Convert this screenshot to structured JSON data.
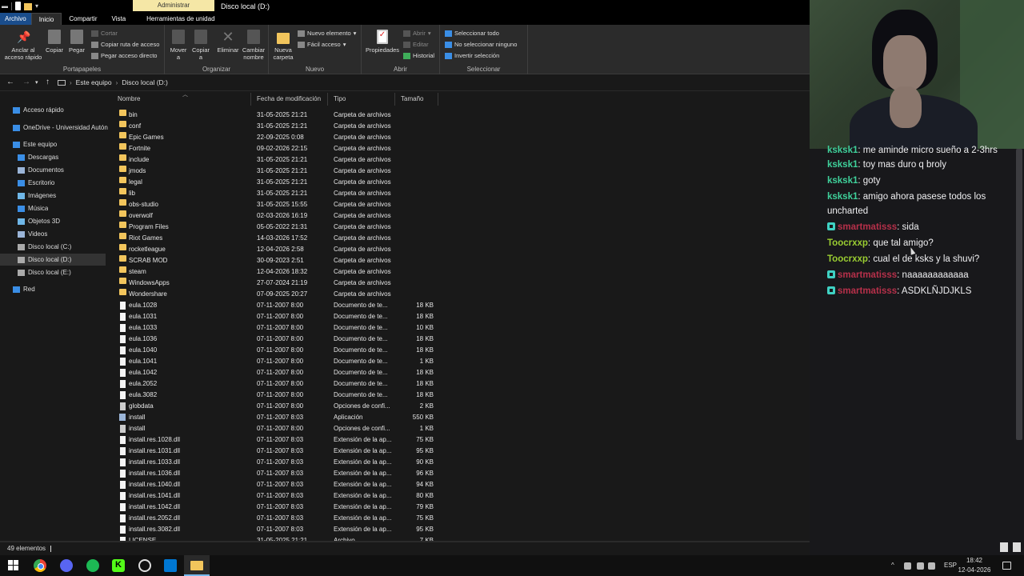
{
  "window": {
    "contextual_tab_title": "Administrar",
    "title": "Disco local (D:)"
  },
  "ribbon_tabs": [
    "Archivo",
    "Inicio",
    "Compartir",
    "Vista",
    "Herramientas de unidad"
  ],
  "ribbon": {
    "clipboard": {
      "pin_label": "Anclar al acceso rápido",
      "copy_label": "Copiar",
      "paste_label": "Pegar",
      "cut_label": "Cortar",
      "copy_path_label": "Copiar ruta de acceso",
      "paste_shortcut_label": "Pegar acceso directo",
      "group_label": "Portapapeles"
    },
    "organize": {
      "move_label": "Mover a",
      "copy_to_label": "Copiar a",
      "delete_label": "Eliminar",
      "rename_label": "Cambiar nombre",
      "group_label": "Organizar"
    },
    "new": {
      "new_folder_label": "Nueva carpeta",
      "new_item_label": "Nuevo elemento",
      "easy_access_label": "Fácil acceso",
      "group_label": "Nuevo"
    },
    "open": {
      "properties_label": "Propiedades",
      "open_label": "Abrir",
      "edit_label": "Editar",
      "history_label": "Historial",
      "group_label": "Abrir"
    },
    "select": {
      "select_all_label": "Seleccionar todo",
      "select_none_label": "No seleccionar ninguno",
      "invert_label": "Invertir selección",
      "group_label": "Seleccionar"
    }
  },
  "address": {
    "crumbs": [
      "Este equipo",
      "Disco local (D:)"
    ]
  },
  "nav_pane": [
    {
      "label": "Acceso rápido",
      "icon": "star-icon",
      "color": "#3a8ee6"
    },
    {
      "label": "OneDrive - Universidad Autón",
      "icon": "cloud-icon",
      "color": "#3a8ee6"
    },
    {
      "label": "Este equipo",
      "icon": "pc-icon",
      "color": "#3a8ee6"
    },
    {
      "label": "Descargas",
      "icon": "download-icon",
      "color": "#3a8ee6"
    },
    {
      "label": "Documentos",
      "icon": "document-icon",
      "color": "#9bb5d8"
    },
    {
      "label": "Escritorio",
      "icon": "desktop-icon",
      "color": "#3a8ee6"
    },
    {
      "label": "Imágenes",
      "icon": "image-icon",
      "color": "#6fb7e8"
    },
    {
      "label": "Música",
      "icon": "music-icon",
      "color": "#3a8ee6"
    },
    {
      "label": "Objetos 3D",
      "icon": "cube-icon",
      "color": "#6fb7e8"
    },
    {
      "label": "Videos",
      "icon": "video-icon",
      "color": "#9bb5d8"
    },
    {
      "label": "Disco local (C:)",
      "icon": "drive-icon",
      "color": "#aaa"
    },
    {
      "label": "Disco local (D:)",
      "icon": "drive-icon",
      "color": "#aaa",
      "selected": true
    },
    {
      "label": "Disco local (E:)",
      "icon": "drive-icon",
      "color": "#aaa"
    },
    {
      "label": "Red",
      "icon": "network-icon",
      "color": "#3a8ee6"
    }
  ],
  "columns": {
    "name": "Nombre",
    "modified": "Fecha de modificación",
    "type": "Tipo",
    "size": "Tamaño"
  },
  "files": [
    {
      "name": "bin",
      "date": "31-05-2025 21:21",
      "type": "Carpeta de archivos",
      "size": "",
      "kind": "folder"
    },
    {
      "name": "conf",
      "date": "31-05-2025 21:21",
      "type": "Carpeta de archivos",
      "size": "",
      "kind": "folder"
    },
    {
      "name": "Epic Games",
      "date": "22-09-2025 0:08",
      "type": "Carpeta de archivos",
      "size": "",
      "kind": "folder"
    },
    {
      "name": "Fortnite",
      "date": "09-02-2026 22:15",
      "type": "Carpeta de archivos",
      "size": "",
      "kind": "folder"
    },
    {
      "name": "include",
      "date": "31-05-2025 21:21",
      "type": "Carpeta de archivos",
      "size": "",
      "kind": "folder"
    },
    {
      "name": "jmods",
      "date": "31-05-2025 21:21",
      "type": "Carpeta de archivos",
      "size": "",
      "kind": "folder"
    },
    {
      "name": "legal",
      "date": "31-05-2025 21:21",
      "type": "Carpeta de archivos",
      "size": "",
      "kind": "folder"
    },
    {
      "name": "lib",
      "date": "31-05-2025 21:21",
      "type": "Carpeta de archivos",
      "size": "",
      "kind": "folder"
    },
    {
      "name": "obs-studio",
      "date": "31-05-2025 15:55",
      "type": "Carpeta de archivos",
      "size": "",
      "kind": "folder"
    },
    {
      "name": "overwolf",
      "date": "02-03-2026 16:19",
      "type": "Carpeta de archivos",
      "size": "",
      "kind": "folder"
    },
    {
      "name": "Program Files",
      "date": "05-05-2022 21:31",
      "type": "Carpeta de archivos",
      "size": "",
      "kind": "folder"
    },
    {
      "name": "Riot Games",
      "date": "14-03-2026 17:52",
      "type": "Carpeta de archivos",
      "size": "",
      "kind": "folder"
    },
    {
      "name": "rocketleague",
      "date": "12-04-2026 2:58",
      "type": "Carpeta de archivos",
      "size": "",
      "kind": "folder"
    },
    {
      "name": "SCRAB MOD",
      "date": "30-09-2023 2:51",
      "type": "Carpeta de archivos",
      "size": "",
      "kind": "folder"
    },
    {
      "name": "steam",
      "date": "12-04-2026 18:32",
      "type": "Carpeta de archivos",
      "size": "",
      "kind": "folder"
    },
    {
      "name": "WindowsApps",
      "date": "27-07-2024 21:19",
      "type": "Carpeta de archivos",
      "size": "",
      "kind": "folder"
    },
    {
      "name": "Wondershare",
      "date": "07-09-2025 20:27",
      "type": "Carpeta de archivos",
      "size": "",
      "kind": "folder"
    },
    {
      "name": "eula.1028",
      "date": "07-11-2007 8:00",
      "type": "Documento de te...",
      "size": "18 KB",
      "kind": "doc"
    },
    {
      "name": "eula.1031",
      "date": "07-11-2007 8:00",
      "type": "Documento de te...",
      "size": "18 KB",
      "kind": "doc"
    },
    {
      "name": "eula.1033",
      "date": "07-11-2007 8:00",
      "type": "Documento de te...",
      "size": "10 KB",
      "kind": "doc"
    },
    {
      "name": "eula.1036",
      "date": "07-11-2007 8:00",
      "type": "Documento de te...",
      "size": "18 KB",
      "kind": "doc"
    },
    {
      "name": "eula.1040",
      "date": "07-11-2007 8:00",
      "type": "Documento de te...",
      "size": "18 KB",
      "kind": "doc"
    },
    {
      "name": "eula.1041",
      "date": "07-11-2007 8:00",
      "type": "Documento de te...",
      "size": "1 KB",
      "kind": "doc"
    },
    {
      "name": "eula.1042",
      "date": "07-11-2007 8:00",
      "type": "Documento de te...",
      "size": "18 KB",
      "kind": "doc"
    },
    {
      "name": "eula.2052",
      "date": "07-11-2007 8:00",
      "type": "Documento de te...",
      "size": "18 KB",
      "kind": "doc"
    },
    {
      "name": "eula.3082",
      "date": "07-11-2007 8:00",
      "type": "Documento de te...",
      "size": "18 KB",
      "kind": "doc"
    },
    {
      "name": "globdata",
      "date": "07-11-2007 8:00",
      "type": "Opciones de confi...",
      "size": "2 KB",
      "kind": "cfg"
    },
    {
      "name": "install",
      "date": "07-11-2007 8:03",
      "type": "Aplicación",
      "size": "550 KB",
      "kind": "app"
    },
    {
      "name": "install",
      "date": "07-11-2007 8:00",
      "type": "Opciones de confi...",
      "size": "1 KB",
      "kind": "cfg"
    },
    {
      "name": "install.res.1028.dll",
      "date": "07-11-2007 8:03",
      "type": "Extensión de la ap...",
      "size": "75 KB",
      "kind": "doc"
    },
    {
      "name": "install.res.1031.dll",
      "date": "07-11-2007 8:03",
      "type": "Extensión de la ap...",
      "size": "95 KB",
      "kind": "doc"
    },
    {
      "name": "install.res.1033.dll",
      "date": "07-11-2007 8:03",
      "type": "Extensión de la ap...",
      "size": "90 KB",
      "kind": "doc"
    },
    {
      "name": "install.res.1036.dll",
      "date": "07-11-2007 8:03",
      "type": "Extensión de la ap...",
      "size": "96 KB",
      "kind": "doc"
    },
    {
      "name": "install.res.1040.dll",
      "date": "07-11-2007 8:03",
      "type": "Extensión de la ap...",
      "size": "94 KB",
      "kind": "doc"
    },
    {
      "name": "install.res.1041.dll",
      "date": "07-11-2007 8:03",
      "type": "Extensión de la ap...",
      "size": "80 KB",
      "kind": "doc"
    },
    {
      "name": "install.res.1042.dll",
      "date": "07-11-2007 8:03",
      "type": "Extensión de la ap...",
      "size": "79 KB",
      "kind": "doc"
    },
    {
      "name": "install.res.2052.dll",
      "date": "07-11-2007 8:03",
      "type": "Extensión de la ap...",
      "size": "75 KB",
      "kind": "doc"
    },
    {
      "name": "install.res.3082.dll",
      "date": "07-11-2007 8:03",
      "type": "Extensión de la ap...",
      "size": "95 KB",
      "kind": "doc"
    },
    {
      "name": "LICENSE",
      "date": "31-05-2025 21:21",
      "type": "Archivo",
      "size": "7 KB",
      "kind": "doc"
    }
  ],
  "status": {
    "count": "49 elementos"
  },
  "chat": {
    "messages": [
      {
        "user": "ksksk1",
        "text": "me aminde micro sueño a 2-3hrs",
        "color": "#3fd19b",
        "badge": false
      },
      {
        "user": "ksksk1",
        "text": "toy mas duro q broly",
        "color": "#3fd19b",
        "badge": false
      },
      {
        "user": "ksksk1",
        "text": "goty",
        "color": "#3fd19b",
        "badge": false
      },
      {
        "user": "ksksk1",
        "text": "amigo ahora pasese todos los uncharted",
        "color": "#3fd19b",
        "badge": false
      },
      {
        "user": "smartmatisss",
        "text": "sida",
        "color": "#b7304a",
        "badge": true
      },
      {
        "user": "Toocrxxp",
        "text": "que tal amigo?",
        "color": "#9acd32",
        "badge": false
      },
      {
        "user": "Toocrxxp",
        "text": "cual el de ksks y la shuvi?",
        "color": "#9acd32",
        "badge": false
      },
      {
        "user": "smartmatisss",
        "text": "naaaaaaaaaaaa",
        "color": "#b7304a",
        "badge": true
      },
      {
        "user": "smartmatisss",
        "text": "ASDKLÑJDJKLS",
        "color": "#b7304a",
        "badge": true
      }
    ]
  },
  "taskbar": {
    "apps": [
      "windows-start-icon",
      "chrome-icon",
      "discord-icon",
      "spotify-icon",
      "kick-icon",
      "obs-icon",
      "vscode-icon",
      "file-explorer-icon"
    ],
    "language": "ESP",
    "time": "18:42",
    "date": "12-04-2026"
  }
}
